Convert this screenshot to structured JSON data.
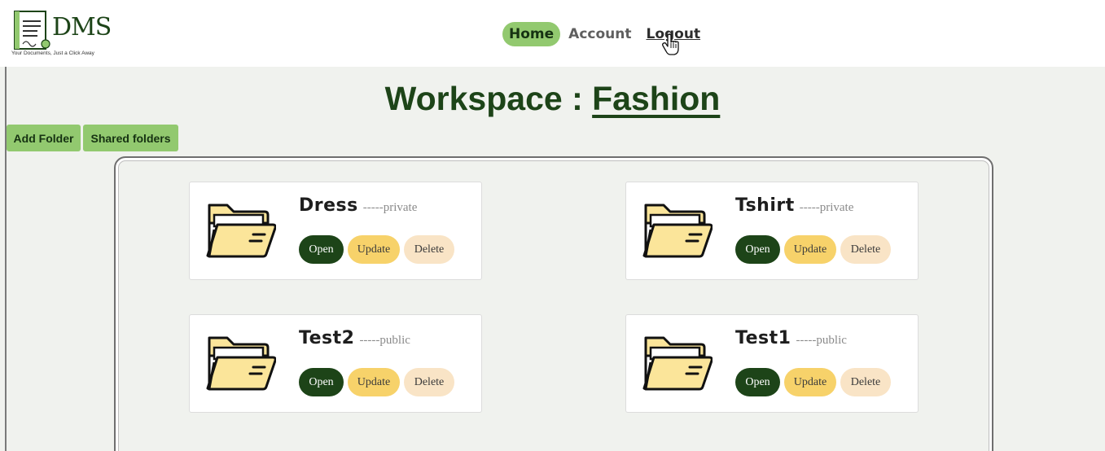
{
  "app": {
    "logo_text": "DMS",
    "tagline": "Your Documents, Just a Click Away"
  },
  "nav": {
    "home": "Home",
    "account": "Account",
    "logout": "Logout"
  },
  "workspace": {
    "label": "Workspace :",
    "name": "Fashion"
  },
  "actions": {
    "add_folder": "Add Folder",
    "shared_folders": "Shared folders"
  },
  "folders": [
    {
      "name": "Dress",
      "visibility": "-----private",
      "open": "Open",
      "update": "Update",
      "delete": "Delete"
    },
    {
      "name": "Tshirt",
      "visibility": "-----private",
      "open": "Open",
      "update": "Update",
      "delete": "Delete"
    },
    {
      "name": "Test2",
      "visibility": "-----public",
      "open": "Open",
      "update": "Update",
      "delete": "Delete"
    },
    {
      "name": "Test1",
      "visibility": "-----public",
      "open": "Open",
      "update": "Update",
      "delete": "Delete"
    }
  ],
  "colors": {
    "brand_dark_green": "#1d4418",
    "nav_active_green": "#92c96f",
    "update_yellow": "#f7d26a",
    "delete_cream": "#f9e4c6",
    "folder_fill": "#fbe59a"
  },
  "icons": {
    "logo": "document-logo-icon",
    "folder": "folder-open-icon",
    "cursor": "hand-pointer-icon"
  }
}
